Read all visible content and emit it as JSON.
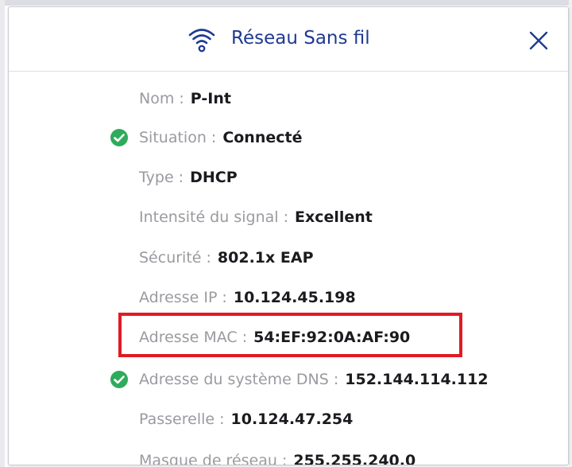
{
  "dialog": {
    "title": "Réseau Sans fil",
    "header_icon": "wifi-icon",
    "close_icon": "close-icon",
    "accent_color": "#1f3a93",
    "status_ok_color": "#2eab5b",
    "highlight_color": "#e01b24"
  },
  "fields": [
    {
      "label": "Nom :",
      "value": "P-Int",
      "status_icon": ""
    },
    {
      "label": "Situation :",
      "value": "Connecté",
      "status_icon": "check-circle-icon"
    },
    {
      "label": "Type :",
      "value": "DHCP",
      "status_icon": ""
    },
    {
      "label": "Intensité du signal :",
      "value": "Excellent",
      "status_icon": ""
    },
    {
      "label": "Sécurité :",
      "value": "802.1x EAP",
      "status_icon": ""
    },
    {
      "label": "Adresse IP :",
      "value": "10.124.45.198",
      "status_icon": ""
    },
    {
      "label": "Adresse MAC :",
      "value": "54:EF:92:0A:AF:90",
      "status_icon": "",
      "highlighted": true
    },
    {
      "label": "Adresse du système DNS :",
      "value": "152.144.114.112",
      "status_icon": "check-circle-icon"
    },
    {
      "label": "Passerelle :",
      "value": "10.124.47.254",
      "status_icon": ""
    },
    {
      "label": "Masque de réseau :",
      "value": "255.255.240.0",
      "status_icon": ""
    }
  ]
}
